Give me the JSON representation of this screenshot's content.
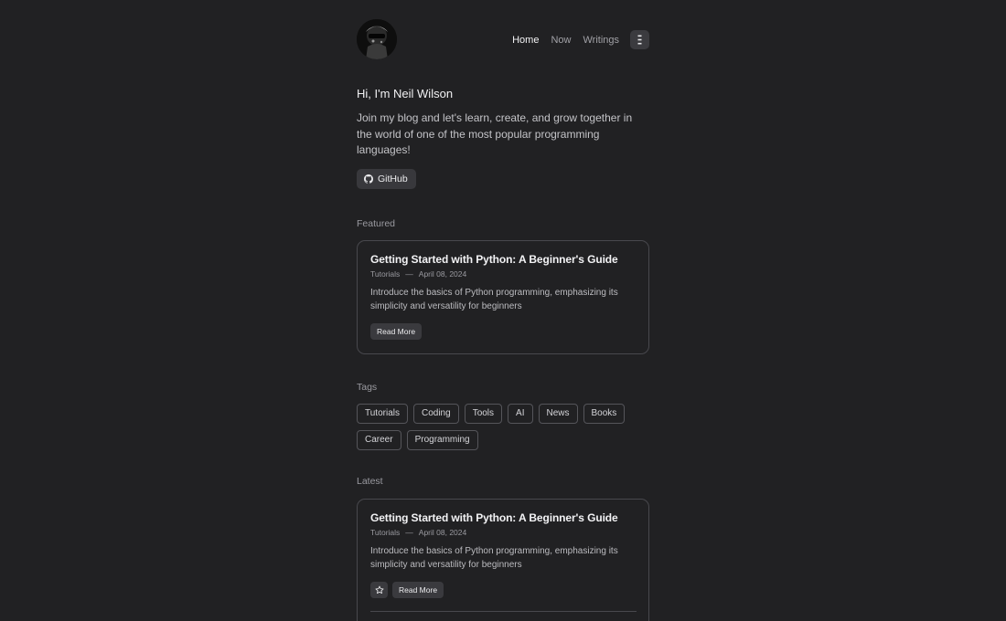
{
  "header": {
    "avatar_alt": "avatar",
    "nav": [
      {
        "label": "Home",
        "active": true
      },
      {
        "label": "Now",
        "active": false
      },
      {
        "label": "Writings",
        "active": false
      }
    ],
    "menu_icon": "menu-dots-icon"
  },
  "intro": {
    "greeting": "Hi, I'm Neil Wilson",
    "text": "Join my blog and let's learn, create, and grow together in the world of one of the most popular programming languages!",
    "github_label": "GitHub",
    "github_icon": "github-icon"
  },
  "featured": {
    "label": "Featured",
    "post": {
      "title": "Getting Started with Python: A Beginner's Guide",
      "category": "Tutorials",
      "separator": "—",
      "date": "April 08, 2024",
      "description": "Introduce the basics of Python programming, emphasizing its simplicity and versatility for beginners",
      "read_more": "Read More"
    }
  },
  "tags": {
    "label": "Tags",
    "items": [
      "Tutorials",
      "Coding",
      "Tools",
      "AI",
      "News",
      "Books",
      "Career",
      "Programming"
    ]
  },
  "latest": {
    "label": "Latest",
    "post": {
      "title": "Getting Started with Python: A Beginner's Guide",
      "category": "Tutorials",
      "separator": "—",
      "date": "April 08, 2024",
      "description": "Introduce the basics of Python programming, emphasizing its simplicity and versatility for beginners",
      "read_more": "Read More",
      "star_icon": "star-icon"
    }
  },
  "colors": {
    "background": "#212123",
    "card_border": "#48484d",
    "button_bg": "#38383c"
  }
}
